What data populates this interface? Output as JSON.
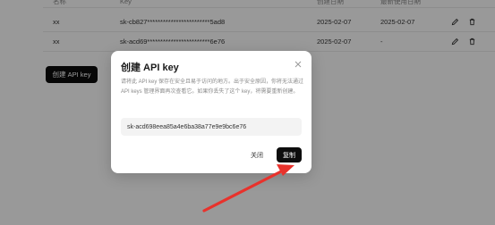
{
  "table": {
    "headers": [
      "名称",
      "Key",
      "创建日期",
      "最新使用日期"
    ],
    "rows": [
      {
        "name": "xx",
        "key": "sk-cb827************************5ad8",
        "created": "2025-02-07",
        "last_used": "2025-02-07"
      },
      {
        "name": "xx",
        "key": "sk-acd69************************6e76",
        "created": "2025-02-07",
        "last_used": "-"
      }
    ],
    "row_icons": [
      "pencil-icon",
      "trash-icon"
    ]
  },
  "create_button_label": "创建 API key",
  "modal": {
    "title": "创建 API key",
    "description": "请将此 API key 保存在安全且易于访问的地方。出于安全原因，你将无法通过 API keys 管理界面再次查看它。如果你丢失了这个 key，将需要重新创建。",
    "key_value": "sk-acd698eea85a4e6ba38a77e9e9bc6e76",
    "close_label": "关闭",
    "copy_label": "复制",
    "close_icon": "close-icon"
  },
  "colors": {
    "primary": "#0d0d0d",
    "annotation_arrow": "#e8322c",
    "overlay": "rgba(0,0,0,0.40)"
  }
}
